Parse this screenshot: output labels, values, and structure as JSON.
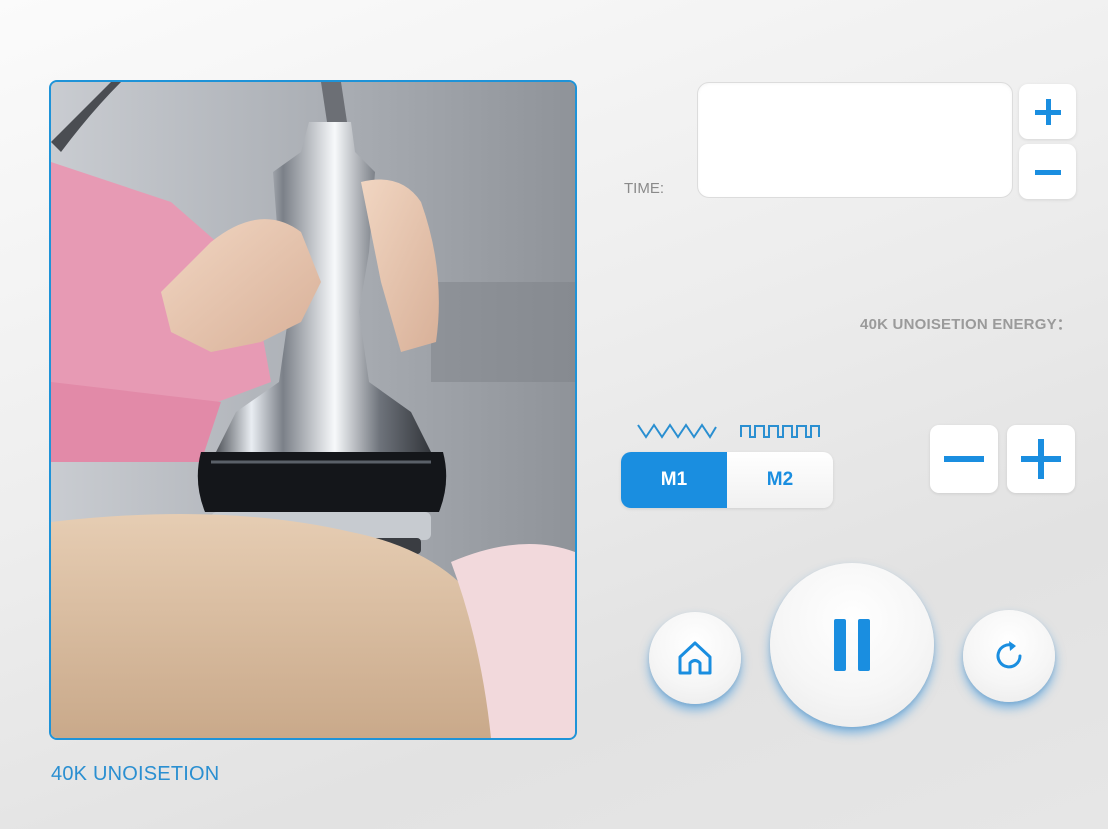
{
  "photo": {
    "caption": "40K UNOISETION"
  },
  "time": {
    "label": "TIME:",
    "value": ""
  },
  "energy": {
    "label": "40K UNOISETION ENERGY："
  },
  "modes": [
    {
      "label": "M1",
      "wave_icon": "sine-wave-icon",
      "active": true
    },
    {
      "label": "M2",
      "wave_icon": "square-wave-icon",
      "active": false
    }
  ],
  "controls": {
    "home_icon": "home-icon",
    "pause_icon": "pause-icon",
    "reset_icon": "refresh-icon"
  },
  "colors": {
    "accent": "#1a8ee0",
    "frame_border": "#1e93d8",
    "caption": "#2a8fd1",
    "label_gray": "#8a8a8a"
  }
}
